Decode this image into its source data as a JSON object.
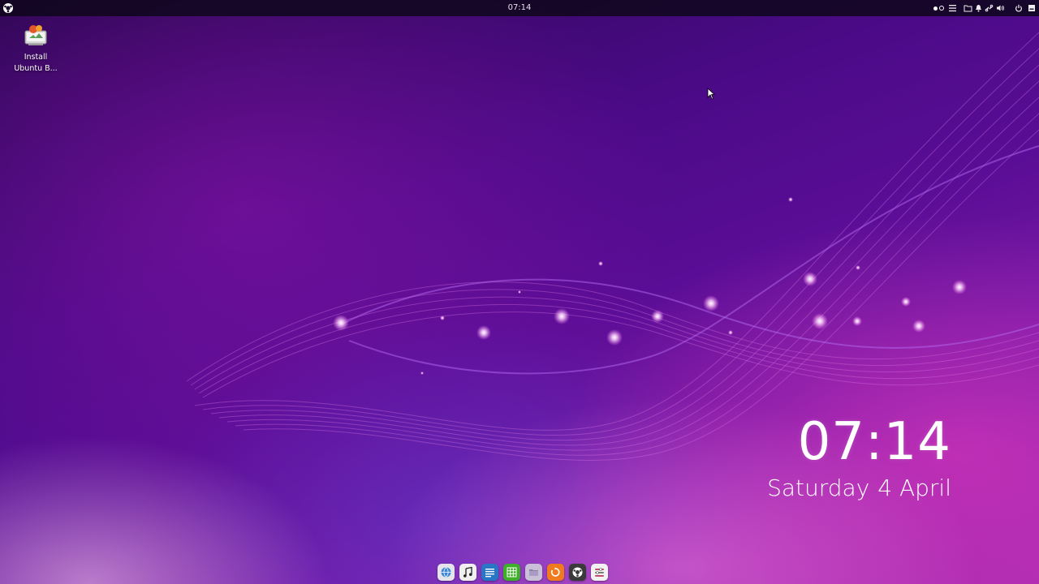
{
  "panel": {
    "clock": "07:14",
    "logo_icon": "ubuntu-budgie-logo-icon",
    "tray_icons": [
      "workspace-switcher-icon",
      "raven-menu-icon",
      "files-icon",
      "notification-bell-icon",
      "network-icon",
      "volume-icon",
      "power-icon",
      "show-desktop-icon"
    ]
  },
  "desktop_icons": [
    {
      "line1": "Install",
      "line2": "Ubuntu B...",
      "icon": "installer-icon"
    }
  ],
  "clock_widget": {
    "time": "07:14",
    "weekday": "Saturday",
    "date": "4 April"
  },
  "dock": {
    "items": [
      {
        "name": "web-browser-icon",
        "color": "#e4e4ea"
      },
      {
        "name": "music-player-icon",
        "color": "#f0f0f0"
      },
      {
        "name": "text-editor-icon",
        "color": "#2a76c6"
      },
      {
        "name": "spreadsheet-icon",
        "color": "#3fae2a"
      },
      {
        "name": "file-manager-icon",
        "color": "#c9c0d8"
      },
      {
        "name": "software-center-icon",
        "color": "#f07a1e"
      },
      {
        "name": "budgie-welcome-icon",
        "color": "#3a3a3a"
      },
      {
        "name": "settings-icon",
        "color": "#f2f2f2"
      }
    ]
  },
  "colors": {
    "panel": "#10061e",
    "wallpaper_base": "#4a0a86",
    "wallpaper_accent": "#e34fc8"
  }
}
